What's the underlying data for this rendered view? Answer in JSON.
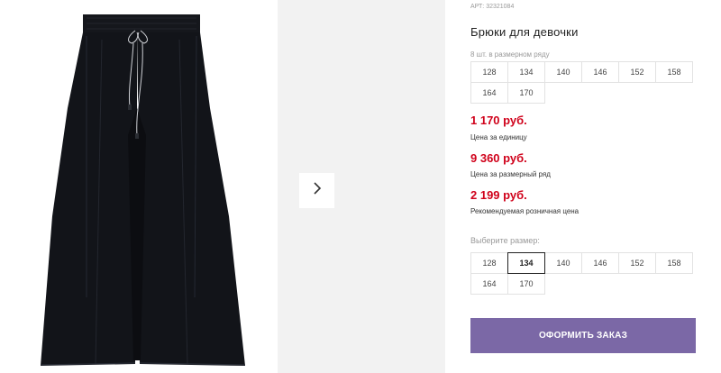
{
  "product": {
    "article": "АРТ: 32321084",
    "title": "Брюки для девочки",
    "size_row_note": "8 шт. в размерном ряду",
    "size_row": [
      "128",
      "134",
      "140",
      "146",
      "152",
      "158",
      "164",
      "170"
    ],
    "prices": {
      "unit_price": "1 170 руб.",
      "unit_price_label": "Цена за единицу",
      "row_price": "9 360 руб.",
      "row_price_label": "Цена за размерный ряд",
      "retail_price": "2 199 руб.",
      "retail_price_label": "Рекомендуемая розничная цена"
    },
    "choose_size_label": "Выберите размер:",
    "size_options": [
      "128",
      "134",
      "140",
      "146",
      "152",
      "158",
      "164",
      "170"
    ],
    "selected_size": "134",
    "order_button": "ОФОРМИТЬ ЗАКАЗ"
  },
  "gallery": {
    "main_image": "black-wide-leg-trousers",
    "next_icon": "chevron-right-icon"
  },
  "colors": {
    "price": "#d0021b",
    "order_button": "#7b68a6",
    "thumb_background": "#f2f2f2"
  }
}
